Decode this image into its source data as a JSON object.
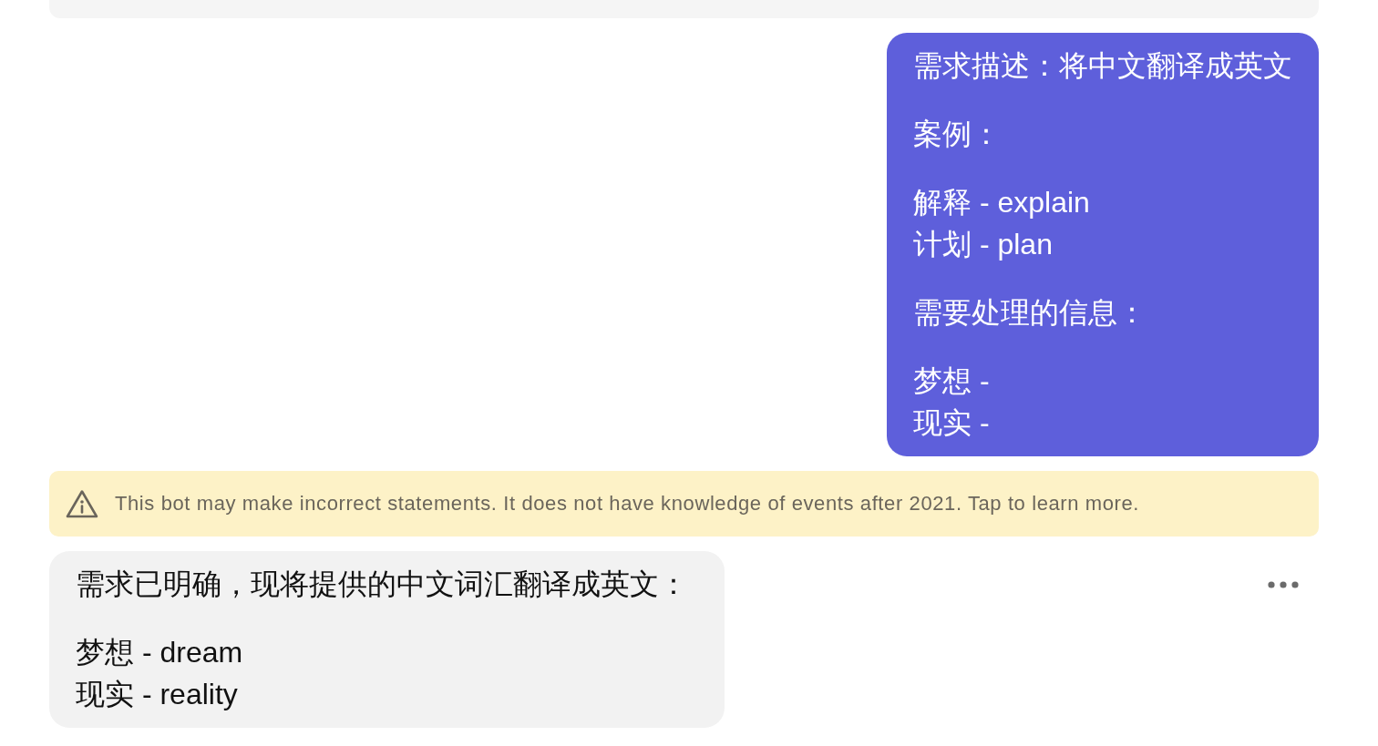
{
  "chat": [
    {
      "kind": "bot_message"
    },
    {
      "kind": "user_message",
      "paragraphs": [
        [
          "需求描述：将中文翻译成英文"
        ],
        [
          "案例："
        ],
        [
          "解释 - explain",
          "计划 - plan"
        ],
        [
          "需要处理的信息："
        ],
        [
          "梦想 -",
          "现实 -"
        ]
      ]
    },
    {
      "kind": "notice",
      "text": "This bot may make incorrect statements. It does not have knowledge of events after 2021. Tap to learn more."
    },
    {
      "kind": "bot_message",
      "menu": true,
      "paragraphs": [
        [
          "需求已明确，现将提供的中文词汇翻译成英文："
        ],
        [
          "梦想 - dream",
          "现实 - reality"
        ]
      ]
    }
  ]
}
